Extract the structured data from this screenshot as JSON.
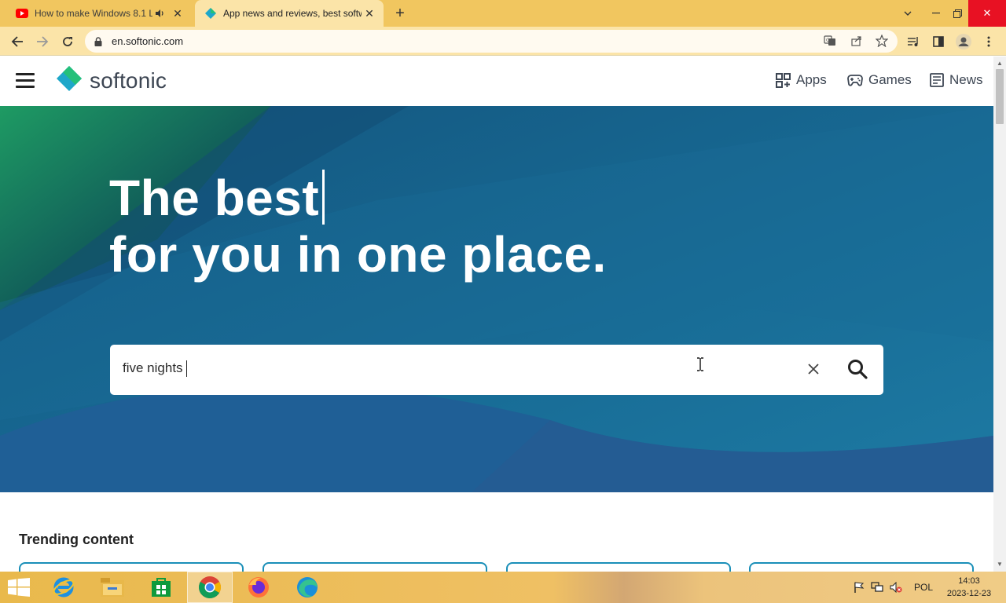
{
  "browser": {
    "tabs": [
      {
        "title": "How to make Windows 8.1 L",
        "favicon": "youtube-icon",
        "active": false
      },
      {
        "title": "App news and reviews, best softw",
        "favicon": "softonic-icon",
        "active": true
      }
    ],
    "url": "en.softonic.com"
  },
  "site": {
    "logo_text": "softonic",
    "nav": [
      {
        "label": "Apps",
        "icon": "grid-icon"
      },
      {
        "label": "Games",
        "icon": "gamepad-icon"
      },
      {
        "label": "News",
        "icon": "newspaper-icon"
      }
    ],
    "hero": {
      "line1": "The best",
      "line2": "for you in one place."
    },
    "search": {
      "value": "five nights "
    },
    "trending_title": "Trending content"
  },
  "taskbar": {
    "language": "POL",
    "time": "14:03",
    "date": "2023-12-23"
  },
  "colors": {
    "tab_strip": "#f1c65f",
    "toolbar": "#fbe4a8",
    "hero_blue": "#1b6a94",
    "hero_green": "#1d8a5e",
    "text_dark": "#3d4653"
  }
}
